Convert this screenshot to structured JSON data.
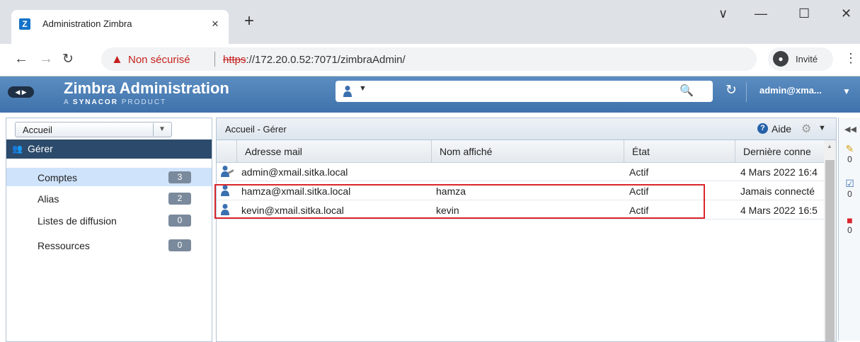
{
  "browser": {
    "tab_title": "Administration Zimbra",
    "tab_close": "×",
    "new_tab": "+",
    "window_controls": [
      "∨",
      "—",
      "☐",
      "✕"
    ],
    "security_label": "Non sécurisé",
    "url_scheme": "https",
    "url_rest": "://172.20.0.52:7071/zimbraAdmin/",
    "profile_label": "Invité"
  },
  "app": {
    "title": "Zimbra Administration",
    "subtitle_prefix": "A",
    "subtitle_brand": "SYNACOR",
    "subtitle_suffix": "PRODUCT",
    "search_value": "",
    "user": "admin@xma..."
  },
  "sidebar": {
    "breadcrumb": "Accueil",
    "section": "Gérer",
    "items": [
      {
        "label": "Comptes",
        "count": "3"
      },
      {
        "label": "Alias",
        "count": "2"
      },
      {
        "label": "Listes de diffusion",
        "count": "0"
      },
      {
        "label": "Ressources",
        "count": "0"
      }
    ]
  },
  "main": {
    "title": "Accueil - Gérer",
    "help_label": "Aide",
    "columns": [
      "Adresse mail",
      "Nom affiché",
      "État",
      "Dernière conne"
    ],
    "rows": [
      {
        "email": "admin@xmail.sitka.local",
        "name": "",
        "status": "Actif",
        "last": "4 Mars 2022 16:4"
      },
      {
        "email": "hamza@xmail.sitka.local",
        "name": "hamza",
        "status": "Actif",
        "last": "Jamais connecté"
      },
      {
        "email": "kevin@xmail.sitka.local",
        "name": "kevin",
        "status": "Actif",
        "last": "4 Mars 2022 16:5"
      }
    ]
  },
  "rail": {
    "counts": [
      "0",
      "0",
      "0"
    ]
  },
  "colors": {
    "header_blue": "#3f72ab",
    "sidebar_dark": "#2c4a6b",
    "selection": "#cfe3fb",
    "highlight_red": "#d9262c",
    "insecure_red": "#c5221f"
  }
}
